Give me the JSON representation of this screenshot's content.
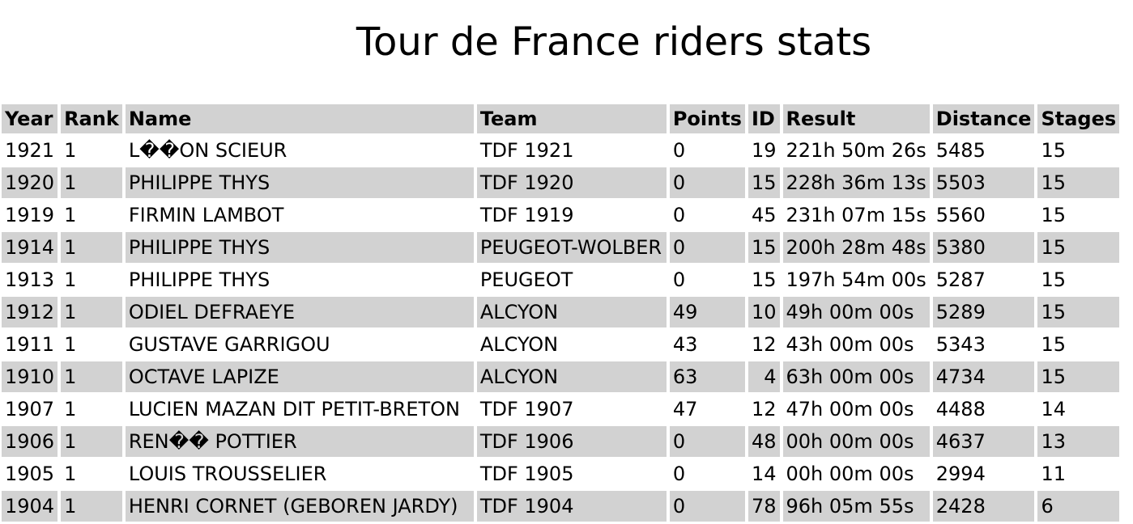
{
  "page": {
    "title": "Tour de France riders stats"
  },
  "table": {
    "headers": [
      "Year",
      "Rank",
      "Name",
      "Team",
      "Points",
      "ID",
      "Result",
      "Distance",
      "Stages"
    ],
    "rows": [
      [
        "1921",
        "1",
        "L��ON SCIEUR",
        "TDF 1921",
        "0",
        "19",
        "221h 50m 26s",
        "5485",
        "15"
      ],
      [
        "1920",
        "1",
        "PHILIPPE THYS",
        "TDF 1920",
        "0",
        "15",
        "228h 36m 13s",
        "5503",
        "15"
      ],
      [
        "1919",
        "1",
        "FIRMIN LAMBOT",
        "TDF 1919",
        "0",
        "45",
        "231h 07m 15s",
        "5560",
        "15"
      ],
      [
        "1914",
        "1",
        "PHILIPPE THYS",
        "PEUGEOT-WOLBER",
        "0",
        "15",
        "200h 28m 48s",
        "5380",
        "15"
      ],
      [
        "1913",
        "1",
        "PHILIPPE THYS",
        "PEUGEOT",
        "0",
        "15",
        "197h 54m 00s",
        "5287",
        "15"
      ],
      [
        "1912",
        "1",
        "ODIEL DEFRAEYE",
        "ALCYON",
        "49",
        "10",
        "49h 00m 00s",
        "5289",
        "15"
      ],
      [
        "1911",
        "1",
        "GUSTAVE GARRIGOU",
        "ALCYON",
        "43",
        "12",
        "43h 00m 00s",
        "5343",
        "15"
      ],
      [
        "1910",
        "1",
        "OCTAVE LAPIZE",
        "ALCYON",
        "63",
        "4",
        "63h 00m 00s",
        "4734",
        "15"
      ],
      [
        "1907",
        "1",
        "LUCIEN MAZAN DIT PETIT-BRETON",
        "TDF 1907",
        "47",
        "12",
        "47h 00m 00s",
        "4488",
        "14"
      ],
      [
        "1906",
        "1",
        "REN�� POTTIER",
        "TDF 1906",
        "0",
        "48",
        "00h 00m 00s",
        "4637",
        "13"
      ],
      [
        "1905",
        "1",
        "LOUIS TROUSSELIER",
        "TDF 1905",
        "0",
        "14",
        "00h 00m 00s",
        "2994",
        "11"
      ],
      [
        "1904",
        "1",
        "HENRI CORNET (GEBOREN JARDY)",
        "TDF 1904",
        "0",
        "78",
        "96h 05m 55s",
        "2428",
        "6"
      ]
    ]
  }
}
